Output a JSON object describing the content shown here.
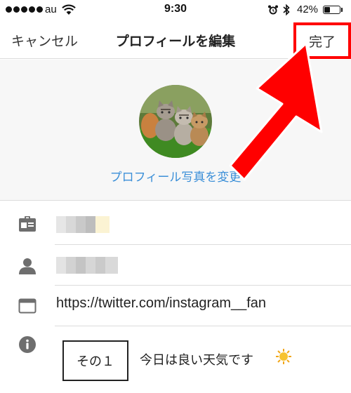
{
  "status_bar": {
    "carrier": "au",
    "time": "9:30",
    "battery_percent_text": "42%",
    "battery_level": 0.42
  },
  "nav": {
    "cancel_label": "キャンセル",
    "title": "プロフィールを編集",
    "done_label": "完了"
  },
  "profile": {
    "change_photo_label": "プロフィール写真を変更",
    "photo_icon": "kittens-photo"
  },
  "fields": {
    "name_icon": "id-card-icon",
    "username_icon": "person-icon",
    "website_icon": "browser-window-icon",
    "website_value": "https://twitter.com/instagram__fan",
    "bio_icon": "info-icon",
    "bio_box_label": "その１",
    "bio_text": "今日は良い天気です"
  },
  "colors": {
    "link_blue": "#3b8fd8",
    "annotation_red": "#ff0000",
    "icon_gray": "#6e6e6e"
  }
}
